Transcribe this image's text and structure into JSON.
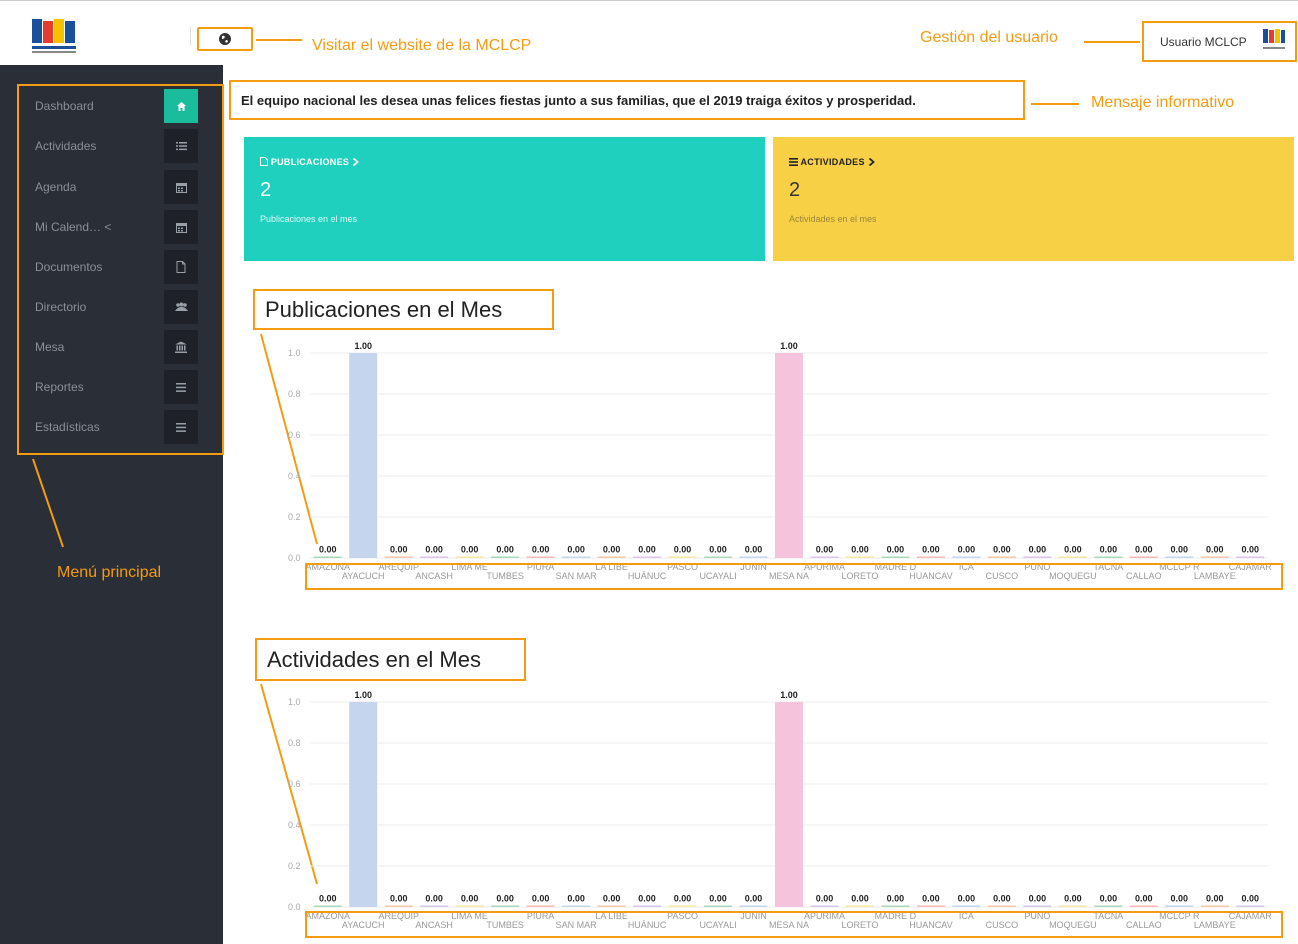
{
  "header": {
    "website_annotation": "Visitar el website de la MCLCP",
    "user_annotation": "Gestión del usuario",
    "user_name": "Usuario MCLCP",
    "colors": {
      "annotation": "#f39c12",
      "accent": "#1abc9c"
    }
  },
  "sidebar": {
    "annotation": "Menú principal",
    "items": [
      {
        "label": "Dashboard",
        "icon": "home-icon",
        "active": true
      },
      {
        "label": "Actividades",
        "icon": "list-icon"
      },
      {
        "label": "Agenda",
        "icon": "calendar-icon"
      },
      {
        "label": "Mi Calend…  <",
        "icon": "calendar-icon"
      },
      {
        "label": "Documentos",
        "icon": "document-icon"
      },
      {
        "label": "Directorio",
        "icon": "users-icon"
      },
      {
        "label": "Mesa",
        "icon": "institution-icon"
      },
      {
        "label": "Reportes",
        "icon": "menu-icon"
      },
      {
        "label": "Estadísticas",
        "icon": "menu-icon"
      }
    ]
  },
  "main": {
    "message": "El equipo nacional les desea unas felices fiestas junto a sus familias, que el 2019 traiga éxitos y prosperidad.",
    "message_annotation": "Mensaje informativo",
    "cards": [
      {
        "title": "PUBLICACIONES",
        "value": "2",
        "subtitle": "Publicaciones en el mes",
        "color": "#1fd0bf"
      },
      {
        "title": "ACTIVIDADES",
        "value": "2",
        "subtitle": "Actividades en el mes",
        "color": "#f7d046"
      }
    ]
  },
  "chart_data": [
    {
      "type": "bar",
      "title": "Publicaciones en el Mes",
      "ylim": [
        0,
        1.0
      ],
      "yticks": [
        "0.0",
        "0.2",
        "0.4",
        "0.6",
        "0.8",
        "1.0"
      ],
      "categories": [
        "AMAZONA",
        "AYACUCH",
        "AREQUIP",
        "ANCASH",
        "LIMA ME",
        "TUMBES",
        "PIURA",
        "SAN MAR",
        "LA LIBE",
        "HUÁNUC",
        "PASCO",
        "UCAYALI",
        "JUNIN",
        "MESA NA",
        "APURIMA",
        "LORETO",
        "MADRE D",
        "HUANCAV",
        "ICA",
        "CUSCO",
        "PUNO",
        "MOQUEGU",
        "TACNA",
        "CALLAO",
        "MCLCP R",
        "LAMBAYE",
        "CAJAMAR"
      ],
      "values": [
        0,
        1,
        0,
        0,
        0,
        0,
        0,
        0,
        0,
        0,
        0,
        0,
        0,
        1,
        0,
        0,
        0,
        0,
        0,
        0,
        0,
        0,
        0,
        0,
        0,
        0,
        0
      ],
      "value_labels": [
        "0.00",
        "1.00",
        "0.00",
        "0.00",
        "0.00",
        "0.00",
        "0.00",
        "0.00",
        "0.00",
        "0.00",
        "0.00",
        "0.00",
        "0.00",
        "1.00",
        "0.00",
        "0.00",
        "0.00",
        "0.00",
        "0.00",
        "0.00",
        "0.00",
        "0.00",
        "0.00",
        "0.00",
        "0.00",
        "0.00",
        "0.00"
      ],
      "bar_colors": [
        "#a8d8b9",
        "#c5d5ee",
        "#f7c6a4",
        "#d9c4ec",
        "#f5e6a6",
        "#a8d8b9",
        "#f7b7b7",
        "#c5d5ee",
        "#f7c6a4",
        "#d9c4ec",
        "#f5e6a6",
        "#a8d8b9",
        "#c5d5ee",
        "#f6c3dc",
        "#d9c4ec",
        "#f5e6a6",
        "#a8d8b9",
        "#f7b7b7",
        "#c5d5ee",
        "#f7c6a4",
        "#d9c4ec",
        "#f5e6a6",
        "#a8d8b9",
        "#f7b7b7",
        "#c5d5ee",
        "#f7c6a4",
        "#d9c4ec"
      ],
      "grid": true
    },
    {
      "type": "bar",
      "title": "Actividades en el Mes",
      "ylim": [
        0,
        1.0
      ],
      "yticks": [
        "0.0",
        "0.2",
        "0.4",
        "0.6",
        "0.8",
        "1.0"
      ],
      "categories": [
        "AMAZONA",
        "AYACUCH",
        "AREQUIP",
        "ANCASH",
        "LIMA ME",
        "TUMBES",
        "PIURA",
        "SAN MAR",
        "LA LIBE",
        "HUÁNUC",
        "PASCO",
        "UCAYALI",
        "JUNIN",
        "MESA NA",
        "APURIMA",
        "LORETO",
        "MADRE D",
        "HUANCAV",
        "ICA",
        "CUSCO",
        "PUNO",
        "MOQUEGU",
        "TACNA",
        "CALLAO",
        "MCLCP R",
        "LAMBAYE",
        "CAJAMAR"
      ],
      "values": [
        0,
        1,
        0,
        0,
        0,
        0,
        0,
        0,
        0,
        0,
        0,
        0,
        0,
        1,
        0,
        0,
        0,
        0,
        0,
        0,
        0,
        0,
        0,
        0,
        0,
        0,
        0
      ],
      "value_labels": [
        "0.00",
        "1.00",
        "0.00",
        "0.00",
        "0.00",
        "0.00",
        "0.00",
        "0.00",
        "0.00",
        "0.00",
        "0.00",
        "0.00",
        "0.00",
        "1.00",
        "0.00",
        "0.00",
        "0.00",
        "0.00",
        "0.00",
        "0.00",
        "0.00",
        "0.00",
        "0.00",
        "0.00",
        "0.00",
        "0.00",
        "0.00"
      ],
      "bar_colors": [
        "#a8d8b9",
        "#c5d5ee",
        "#f7c6a4",
        "#d9c4ec",
        "#f5e6a6",
        "#a8d8b9",
        "#f7b7b7",
        "#c5d5ee",
        "#f7c6a4",
        "#d9c4ec",
        "#f5e6a6",
        "#a8d8b9",
        "#c5d5ee",
        "#f6c3dc",
        "#d9c4ec",
        "#f5e6a6",
        "#a8d8b9",
        "#f7b7b7",
        "#c5d5ee",
        "#f7c6a4",
        "#d9c4ec",
        "#f5e6a6",
        "#a8d8b9",
        "#f7b7b7",
        "#c5d5ee",
        "#f7c6a4",
        "#d9c4ec"
      ],
      "grid": true
    }
  ]
}
